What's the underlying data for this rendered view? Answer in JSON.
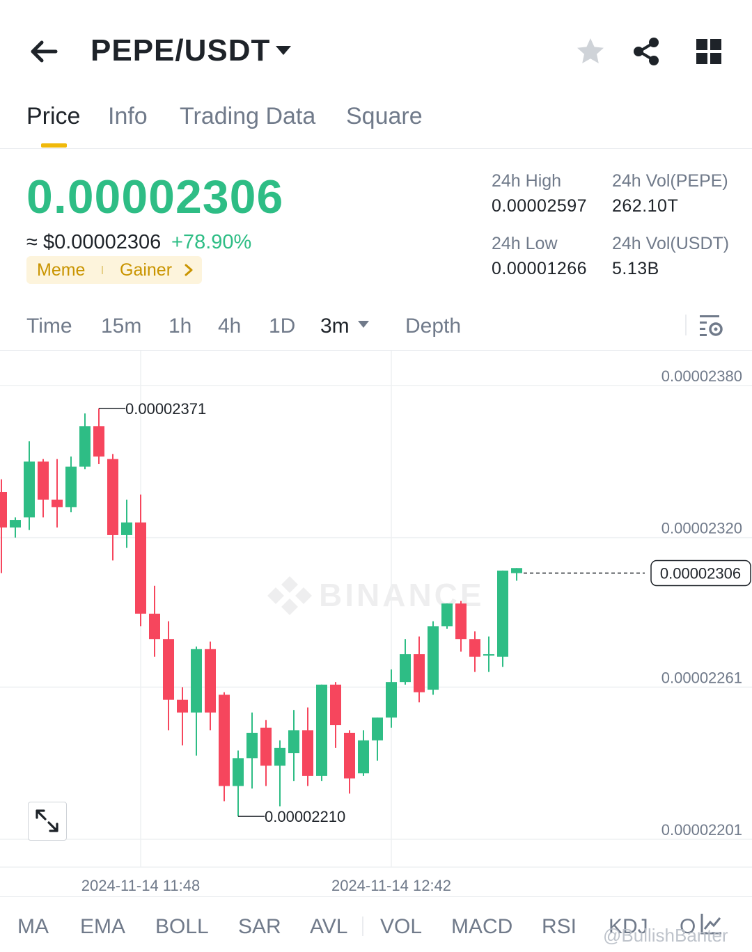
{
  "header": {
    "pair": "PEPE/USDT",
    "icons": [
      "back-arrow-icon",
      "caret-down-icon",
      "star-icon",
      "share-icon",
      "grid-icon"
    ]
  },
  "tabs": [
    {
      "label": "Price",
      "active": true
    },
    {
      "label": "Info",
      "active": false
    },
    {
      "label": "Trading Data",
      "active": false
    },
    {
      "label": "Square",
      "active": false
    }
  ],
  "ticker": {
    "price": "0.00002306",
    "usd_price": "≈ $0.00002306",
    "change": "+78.90%",
    "tags": [
      "Meme",
      "Gainer"
    ],
    "stats": {
      "high_label": "24h High",
      "high_value": "0.00002597",
      "low_label": "24h Low",
      "low_value": "0.00001266",
      "vol_base_label": "24h Vol(PEPE)",
      "vol_base_value": "262.10T",
      "vol_quote_label": "24h Vol(USDT)",
      "vol_quote_value": "5.13B"
    }
  },
  "intervals": {
    "items": [
      "Time",
      "15m",
      "1h",
      "4h",
      "1D",
      "3m",
      "Depth"
    ],
    "active": "3m"
  },
  "chart_data": {
    "type": "candlestick",
    "y_ticks": [
      "0.00002380",
      "0.00002320",
      "0.00002261",
      "0.00002201"
    ],
    "ylim": [
      2.19e-05,
      2.391e-05
    ],
    "x_ticks": [
      "2024-11-14 11:48",
      "2024-11-14 12:42"
    ],
    "current_price": "0.00002306",
    "high_annotation": "0.00002371",
    "low_annotation": "0.00002210",
    "watermark": "BINANCE",
    "colors": {
      "up": "#2ebd85",
      "down": "#f6465d"
    },
    "candles": [
      {
        "o": 2.338e-05,
        "h": 2.343e-05,
        "l": 2.306e-05,
        "c": 2.324e-05
      },
      {
        "o": 2.324e-05,
        "h": 2.328e-05,
        "l": 2.32e-05,
        "c": 2.327e-05
      },
      {
        "o": 2.328e-05,
        "h": 2.358e-05,
        "l": 2.323e-05,
        "c": 2.35e-05
      },
      {
        "o": 2.35e-05,
        "h": 2.351e-05,
        "l": 2.328e-05,
        "c": 2.335e-05
      },
      {
        "o": 2.335e-05,
        "h": 2.351e-05,
        "l": 2.324e-05,
        "c": 2.332e-05
      },
      {
        "o": 2.332e-05,
        "h": 2.352e-05,
        "l": 2.33e-05,
        "c": 2.348e-05
      },
      {
        "o": 2.348e-05,
        "h": 2.369e-05,
        "l": 2.347e-05,
        "c": 2.364e-05
      },
      {
        "o": 2.364e-05,
        "h": 2.371e-05,
        "l": 2.349e-05,
        "c": 2.352e-05
      },
      {
        "o": 2.351e-05,
        "h": 2.353e-05,
        "l": 2.311e-05,
        "c": 2.321e-05
      },
      {
        "o": 2.321e-05,
        "h": 2.335e-05,
        "l": 2.316e-05,
        "c": 2.326e-05
      },
      {
        "o": 2.326e-05,
        "h": 2.337e-05,
        "l": 2.285e-05,
        "c": 2.29e-05
      },
      {
        "o": 2.29e-05,
        "h": 2.301e-05,
        "l": 2.273e-05,
        "c": 2.28e-05
      },
      {
        "o": 2.28e-05,
        "h": 2.287e-05,
        "l": 2.244e-05,
        "c": 2.256e-05
      },
      {
        "o": 2.256e-05,
        "h": 2.261e-05,
        "l": 2.238e-05,
        "c": 2.251e-05
      },
      {
        "o": 2.251e-05,
        "h": 2.277e-05,
        "l": 2.234e-05,
        "c": 2.276e-05
      },
      {
        "o": 2.276e-05,
        "h": 2.279e-05,
        "l": 2.244e-05,
        "c": 2.251e-05
      },
      {
        "o": 2.258e-05,
        "h": 2.259e-05,
        "l": 2.216e-05,
        "c": 2.222e-05
      },
      {
        "o": 2.222e-05,
        "h": 2.236e-05,
        "l": 2.21e-05,
        "c": 2.233e-05
      },
      {
        "o": 2.233e-05,
        "h": 2.251e-05,
        "l": 2.221e-05,
        "c": 2.243e-05
      },
      {
        "o": 2.245e-05,
        "h": 2.248e-05,
        "l": 2.222e-05,
        "c": 2.23e-05
      },
      {
        "o": 2.23e-05,
        "h": 2.24e-05,
        "l": 2.214e-05,
        "c": 2.237e-05
      },
      {
        "o": 2.235e-05,
        "h": 2.252e-05,
        "l": 2.224e-05,
        "c": 2.244e-05
      },
      {
        "o": 2.244e-05,
        "h": 2.253e-05,
        "l": 2.222e-05,
        "c": 2.226e-05
      },
      {
        "o": 2.226e-05,
        "h": 2.262e-05,
        "l": 2.224e-05,
        "c": 2.262e-05
      },
      {
        "o": 2.262e-05,
        "h": 2.263e-05,
        "l": 2.237e-05,
        "c": 2.246e-05
      },
      {
        "o": 2.243e-05,
        "h": 2.244e-05,
        "l": 2.219e-05,
        "c": 2.225e-05
      },
      {
        "o": 2.227e-05,
        "h": 2.244e-05,
        "l": 2.226e-05,
        "c": 2.24e-05
      },
      {
        "o": 2.24e-05,
        "h": 2.249e-05,
        "l": 2.232e-05,
        "c": 2.249e-05
      },
      {
        "o": 2.249e-05,
        "h": 2.268e-05,
        "l": 2.245e-05,
        "c": 2.263e-05
      },
      {
        "o": 2.263e-05,
        "h": 2.28e-05,
        "l": 2.262e-05,
        "c": 2.274e-05
      },
      {
        "o": 2.274e-05,
        "h": 2.281e-05,
        "l": 2.255e-05,
        "c": 2.259e-05
      },
      {
        "o": 2.26e-05,
        "h": 2.287e-05,
        "l": 2.258e-05,
        "c": 2.285e-05
      },
      {
        "o": 2.285e-05,
        "h": 2.294e-05,
        "l": 2.284e-05,
        "c": 2.294e-05
      },
      {
        "o": 2.294e-05,
        "h": 2.295e-05,
        "l": 2.275e-05,
        "c": 2.28e-05
      },
      {
        "o": 2.28e-05,
        "h": 2.283e-05,
        "l": 2.267e-05,
        "c": 2.273e-05
      },
      {
        "o": 2.274e-05,
        "h": 2.281e-05,
        "l": 2.267e-05,
        "c": 2.274e-05
      },
      {
        "o": 2.273e-05,
        "h": 2.307e-05,
        "l": 2.269e-05,
        "c": 2.307e-05
      },
      {
        "o": 2.306e-05,
        "h": 2.308e-05,
        "l": 2.303e-05,
        "c": 2.308e-05
      }
    ]
  },
  "indicators": {
    "items": [
      "MA",
      "EMA",
      "BOLL",
      "SAR",
      "AVL",
      "VOL",
      "MACD",
      "RSI",
      "KDJ",
      "O"
    ]
  },
  "credit": "@BullishBanter"
}
